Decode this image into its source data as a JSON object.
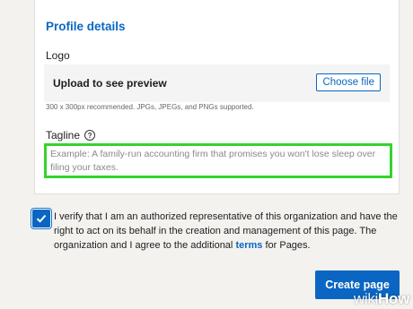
{
  "profile": {
    "title": "Profile details",
    "logo_label": "Logo",
    "upload_text": "Upload to see preview",
    "choose_file_label": "Choose file",
    "hint": "300 x 300px recommended. JPGs, JPEGs, and PNGs supported.",
    "tagline_label": "Tagline",
    "tagline_help_icon": "question-circle-icon",
    "tagline_placeholder": "Example: A family-run accounting firm that promises you won't lose sleep over filing your taxes.",
    "highlight_color": "#35d42c"
  },
  "verification": {
    "checked": true,
    "text_before": "I verify that I am an authorized representative of this organization and have the right to act on its behalf in the creation and management of this page. The organization and I agree to the additional ",
    "terms_link": "terms",
    "text_after": " for Pages."
  },
  "actions": {
    "create_label": "Create page"
  },
  "watermark": {
    "prefix": "wiki",
    "suffix": "How"
  },
  "colors": {
    "accent": "#0a66c2",
    "background": "#f3f2ef"
  }
}
